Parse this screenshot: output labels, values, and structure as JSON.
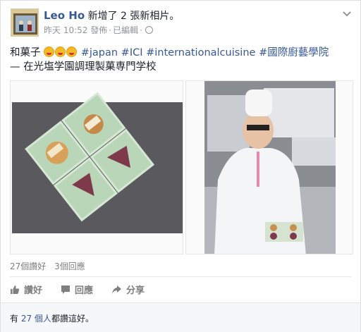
{
  "post": {
    "author": "Leo Ho",
    "action": "新增了 2 張新相片。",
    "timestamp": "昨天 10:52 發佈",
    "edited": "已編輯",
    "privacy_icon": "globe-icon",
    "text_prefix": "和菓子",
    "hashtags": [
      "#japan",
      "#ICI",
      "#internationalcuisine",
      "#國際廚藝學院"
    ],
    "location": "— 在光塩学園調理製菓専門学校"
  },
  "stats": {
    "likes": "27個讚好",
    "comments": "3個回應"
  },
  "actions": {
    "like": "讚好",
    "comment": "回應",
    "share": "分享"
  },
  "footer": {
    "prefix": "有",
    "link": "27 個人",
    "suffix": "都讚這好。"
  },
  "colors": {
    "link": "#365899",
    "muted": "#90949c",
    "plate": "#b9d6b8",
    "mochi": "#7e3a4a"
  }
}
